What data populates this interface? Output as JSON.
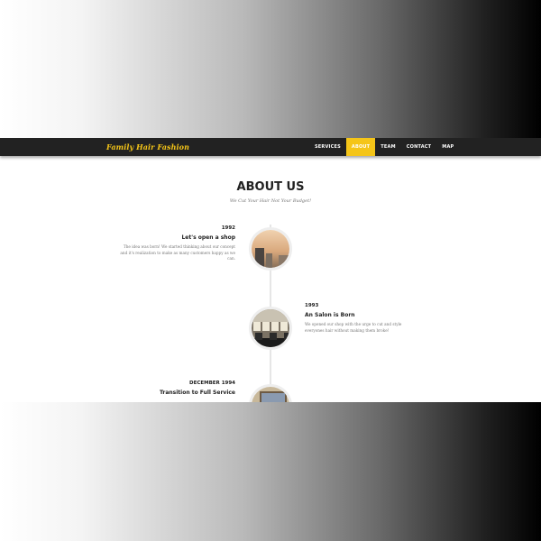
{
  "brand": "Family Hair Fashion",
  "nav": [
    "SERVICES",
    "ABOUT",
    "TEAM",
    "CONTACT",
    "MAP"
  ],
  "nav_active": "ABOUT",
  "section": {
    "title": "ABOUT US",
    "subtitle": "We Cut Your Hair Not Your Budget!"
  },
  "timeline": [
    {
      "year": "1992",
      "heading": "Let's open a shop",
      "description": "The idea was born! We started thinking about our concept and it's realization to make as many customers happy as we can.",
      "image": "shop-photo"
    },
    {
      "year": "1993",
      "heading": "An Salon is Born",
      "description": "We opened our shop with the urge to cut and style everyones hair without making them broke!",
      "image": "salon-interior-photo"
    },
    {
      "year": "DECEMBER 1994",
      "heading": "Transition to Full Service",
      "description": "",
      "image": "mirror-photo"
    }
  ],
  "colors": {
    "accent": "#f5c518",
    "navbar": "#222222"
  }
}
